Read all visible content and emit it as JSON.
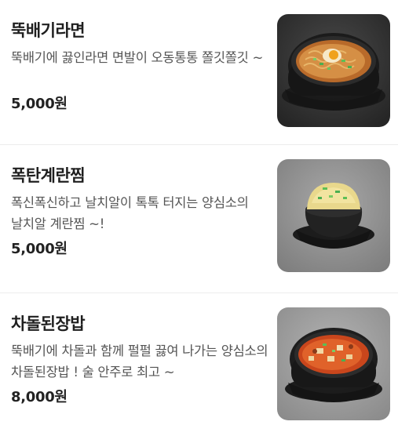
{
  "menu": {
    "items": [
      {
        "name": "뚝배기라면",
        "description": "뚝배기에 끓인라면 면발이 오동통통 쫄깃쫄깃 ~",
        "price": "5,000원",
        "image_icon": "ramen-photo"
      },
      {
        "name": "폭탄계란찜",
        "description": "폭신폭신하고 날치알이 톡톡 터지는 양심소의 날치알 계란찜 ~!",
        "price": "5,000원",
        "image_icon": "steamed-egg-photo"
      },
      {
        "name": "차돌된장밥",
        "description": "뚝배기에 차돌과 함께 펄펄 끓여 나가는 양심소의 차돌된장밥 ! 술 안주로 최고 ~",
        "price": "8,000원",
        "image_icon": "doenjang-stew-photo"
      }
    ]
  }
}
